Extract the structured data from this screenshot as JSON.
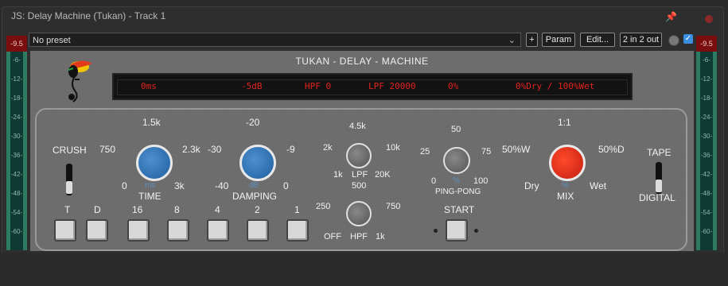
{
  "window": {
    "title": "JS: Delay Machine (Tukan) - Track 1"
  },
  "toolbar": {
    "preset": "No preset",
    "plus_label": "+",
    "param_label": "Param",
    "edit_label": "Edit...",
    "io_label": "2 in 2 out"
  },
  "meters": {
    "peak_left": "-9.5",
    "peak_right": "-9.5",
    "scale": [
      "-6-",
      "-12-",
      "-18-",
      "-24-",
      "-30-",
      "-36-",
      "-42-",
      "-48-",
      "-54-",
      "-60-"
    ]
  },
  "plugin": {
    "title": "TUKAN - DELAY - MACHINE",
    "display": [
      "0ms",
      "-5dB",
      "HPF 0",
      "LPF 20000",
      "0%",
      "0%Dry / 100%Wet"
    ],
    "crush": "CRUSH",
    "time": {
      "label": "TIME",
      "top": "1.5k",
      "left": "750",
      "right": "2.3k",
      "min": "0",
      "max": "3k",
      "unit": "ms"
    },
    "damping": {
      "label": "DAMPING",
      "top": "-20",
      "left": "-30",
      "right": "-9",
      "min": "-40",
      "max": "0",
      "unit": "dB"
    },
    "lpf": {
      "label": "LPF",
      "top": "4.5k",
      "left": "2k",
      "right": "10k",
      "min": "1k",
      "max": "20K"
    },
    "hpf": {
      "label": "HPF",
      "top": "500",
      "left": "250",
      "right": "750",
      "min": "OFF",
      "max": "1k"
    },
    "pingpong": {
      "label": "PING-PONG",
      "top": "50",
      "left": "25",
      "right": "75",
      "min": "0",
      "max": "100",
      "unit": "%"
    },
    "mix": {
      "label": "MIX",
      "top": "1:1",
      "left": "50%W",
      "right": "50%D",
      "min": "Dry",
      "max": "Wet",
      "unit": "%"
    },
    "tape": "TAPE",
    "digital": "DIGITAL",
    "start": "START",
    "divisions": [
      "T",
      "D",
      "16",
      "8",
      "4",
      "2",
      "1"
    ]
  }
}
